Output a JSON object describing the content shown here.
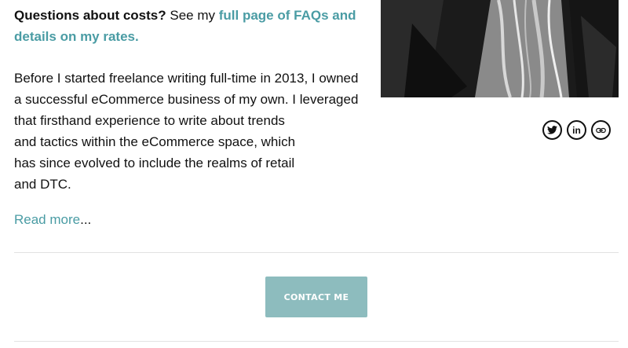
{
  "intro": {
    "bold_prefix": "Questions about costs?",
    "text": " See my ",
    "link_text": "full page of FAQs and details on my rates."
  },
  "bio": {
    "lines": [
      "Before I started freelance writing full-time in 2013, I owned",
      "a successful eCommerce business of my own. I leveraged",
      "that firsthand experience to write about trends",
      "and tactics within the eCommerce space, which",
      "has since evolved to include the realms of retail",
      "and DTC."
    ]
  },
  "read_more": {
    "link_text": "Read more",
    "suffix": "..."
  },
  "social": {
    "icons": [
      "twitter-icon",
      "linkedin-icon",
      "link-icon"
    ],
    "linkedin_label": "in"
  },
  "contact": {
    "label": "CONTACT ME"
  },
  "colors": {
    "accent": "#4a9ca4",
    "button_bg": "#8dbcbe",
    "divider": "#e2e2e2"
  }
}
